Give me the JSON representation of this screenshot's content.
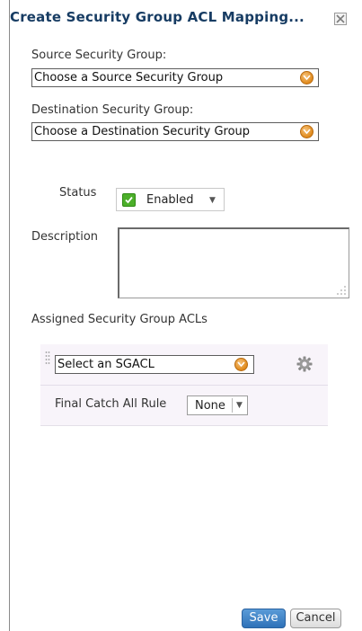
{
  "dialog": {
    "title": "Create Security Group ACL Mapping...",
    "close_icon": "close-x-icon"
  },
  "source_group": {
    "label": "Source Security Group:",
    "selected": "Choose a Source Security Group",
    "icon": "chevron-down-circle-icon"
  },
  "destination_group": {
    "label": "Destination Security Group:",
    "selected": "Choose a Destination Security Group",
    "icon": "chevron-down-circle-icon"
  },
  "status": {
    "label": "Status",
    "value": "Enabled",
    "checked": true,
    "icon": "caret-down-icon"
  },
  "description": {
    "label": "Description",
    "value": ""
  },
  "assigned_acls": {
    "label": "Assigned Security Group ACLs",
    "sgacl_select": "Select an SGACL",
    "gear_icon": "gear-icon",
    "drag_icon": "drag-handle-icon",
    "final_catch_label": "Final Catch All Rule",
    "final_catch_value": "None"
  },
  "buttons": {
    "save": "Save",
    "cancel": "Cancel"
  },
  "colors": {
    "title": "#173c63",
    "accent_orange": "#e08a1c",
    "check_green": "#4caf2a",
    "save_blue": "#2f72b8",
    "acl_panel_bg": "#f8f4fa"
  }
}
